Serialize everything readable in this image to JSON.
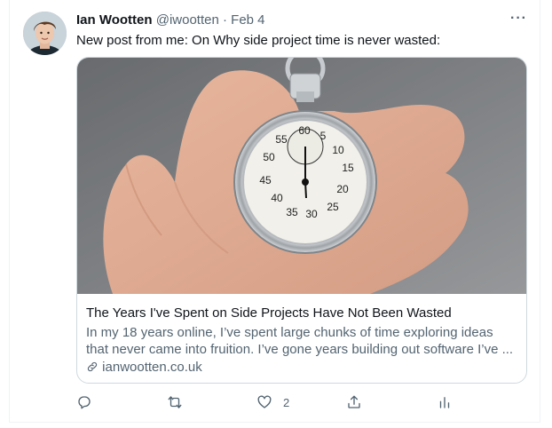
{
  "tweet": {
    "author_name": "Ian Wootten",
    "handle": "@iwootten",
    "separator": "·",
    "date": "Feb 4",
    "more_label": "···",
    "text": "New post from me: On Why side project time is never wasted:",
    "card": {
      "title": "The Years I've Spent on Side Projects Have Not Been Wasted",
      "description_line1": "In my 18 years online, I’ve spent large chunks of time exploring ideas",
      "description_line2": "that never came into fruition. I’ve gone years building out software I’ve ...",
      "domain": "ianwootten.co.uk",
      "image_icon": "stopwatch-in-hand-image"
    },
    "actions": {
      "reply_icon": "reply-icon",
      "retweet_icon": "retweet-icon",
      "like_icon": "heart-icon",
      "like_count": "2",
      "share_icon": "share-icon",
      "analytics_icon": "analytics-icon"
    }
  }
}
